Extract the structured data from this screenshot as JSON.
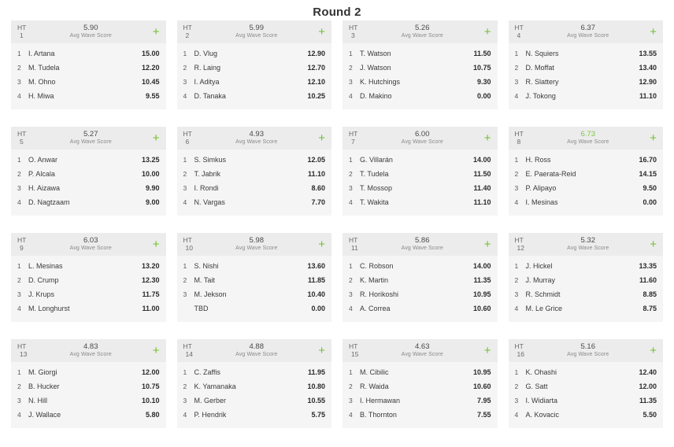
{
  "page": {
    "title": "Round 2",
    "avg_wave_score_label": "Avg Wave Score",
    "heat_prefix": "HT",
    "add_icon": "+",
    "accent_green": "#72c02c",
    "leader_green": "#7ac943",
    "header_bg": "#ececec",
    "card_bg": "#f5f5f5"
  },
  "heats": [
    {
      "number": "1",
      "avg_wave_score": "5.90",
      "is_leader": false,
      "athletes": [
        {
          "seed": "1",
          "name": "I. Artana",
          "score": "15.00"
        },
        {
          "seed": "2",
          "name": "M. Tudela",
          "score": "12.20"
        },
        {
          "seed": "3",
          "name": "M. Ohno",
          "score": "10.45"
        },
        {
          "seed": "4",
          "name": "H. Miwa",
          "score": "9.55"
        }
      ]
    },
    {
      "number": "2",
      "avg_wave_score": "5.99",
      "is_leader": false,
      "athletes": [
        {
          "seed": "1",
          "name": "D. Vlug",
          "score": "12.90"
        },
        {
          "seed": "2",
          "name": "R. Laing",
          "score": "12.70"
        },
        {
          "seed": "3",
          "name": "I. Aditya",
          "score": "12.10"
        },
        {
          "seed": "4",
          "name": "D. Tanaka",
          "score": "10.25"
        }
      ]
    },
    {
      "number": "3",
      "avg_wave_score": "5.26",
      "is_leader": false,
      "athletes": [
        {
          "seed": "1",
          "name": "T. Watson",
          "score": "11.50"
        },
        {
          "seed": "2",
          "name": "J. Watson",
          "score": "10.75"
        },
        {
          "seed": "3",
          "name": "K. Hutchings",
          "score": "9.30"
        },
        {
          "seed": "4",
          "name": "D. Makino",
          "score": "0.00"
        }
      ]
    },
    {
      "number": "4",
      "avg_wave_score": "6.37",
      "is_leader": false,
      "athletes": [
        {
          "seed": "1",
          "name": "N. Squiers",
          "score": "13.55"
        },
        {
          "seed": "2",
          "name": "D. Moffat",
          "score": "13.40"
        },
        {
          "seed": "3",
          "name": "R. Slattery",
          "score": "12.90"
        },
        {
          "seed": "4",
          "name": "J. Tokong",
          "score": "11.10"
        }
      ]
    },
    {
      "number": "5",
      "avg_wave_score": "5.27",
      "is_leader": false,
      "athletes": [
        {
          "seed": "1",
          "name": "O. Anwar",
          "score": "13.25"
        },
        {
          "seed": "2",
          "name": "P. Alcala",
          "score": "10.00"
        },
        {
          "seed": "3",
          "name": "H. Aizawa",
          "score": "9.90"
        },
        {
          "seed": "4",
          "name": "D. Nagtzaam",
          "score": "9.00"
        }
      ]
    },
    {
      "number": "6",
      "avg_wave_score": "4.93",
      "is_leader": false,
      "athletes": [
        {
          "seed": "1",
          "name": "S. Simkus",
          "score": "12.05"
        },
        {
          "seed": "2",
          "name": "T. Jabrik",
          "score": "11.10"
        },
        {
          "seed": "3",
          "name": "I. Rondi",
          "score": "8.60"
        },
        {
          "seed": "4",
          "name": "N. Vargas",
          "score": "7.70"
        }
      ]
    },
    {
      "number": "7",
      "avg_wave_score": "6.00",
      "is_leader": false,
      "athletes": [
        {
          "seed": "1",
          "name": "G. Villarán",
          "score": "14.00"
        },
        {
          "seed": "2",
          "name": "T. Tudela",
          "score": "11.50"
        },
        {
          "seed": "3",
          "name": "T. Mossop",
          "score": "11.40"
        },
        {
          "seed": "4",
          "name": "T. Wakita",
          "score": "11.10"
        }
      ]
    },
    {
      "number": "8",
      "avg_wave_score": "6.73",
      "is_leader": true,
      "athletes": [
        {
          "seed": "1",
          "name": "H. Ross",
          "score": "16.70"
        },
        {
          "seed": "2",
          "name": "E. Paerata-Reid",
          "score": "14.15"
        },
        {
          "seed": "3",
          "name": "P. Alipayo",
          "score": "9.50"
        },
        {
          "seed": "4",
          "name": "I. Mesinas",
          "score": "0.00"
        }
      ]
    },
    {
      "number": "9",
      "avg_wave_score": "6.03",
      "is_leader": false,
      "athletes": [
        {
          "seed": "1",
          "name": "L. Mesinas",
          "score": "13.20"
        },
        {
          "seed": "2",
          "name": "D. Crump",
          "score": "12.30"
        },
        {
          "seed": "3",
          "name": "J. Krups",
          "score": "11.75"
        },
        {
          "seed": "4",
          "name": "M. Longhurst",
          "score": "11.00"
        }
      ]
    },
    {
      "number": "10",
      "avg_wave_score": "5.98",
      "is_leader": false,
      "athletes": [
        {
          "seed": "1",
          "name": "S. Nishi",
          "score": "13.60"
        },
        {
          "seed": "2",
          "name": "M. Tait",
          "score": "11.85"
        },
        {
          "seed": "3",
          "name": "M. Jekson",
          "score": "10.40"
        },
        {
          "seed": "",
          "name": "TBD",
          "score": "0.00"
        }
      ]
    },
    {
      "number": "11",
      "avg_wave_score": "5.86",
      "is_leader": false,
      "athletes": [
        {
          "seed": "1",
          "name": "C. Robson",
          "score": "14.00"
        },
        {
          "seed": "2",
          "name": "K. Martin",
          "score": "11.35"
        },
        {
          "seed": "3",
          "name": "R. Horikoshi",
          "score": "10.95"
        },
        {
          "seed": "4",
          "name": "A. Correa",
          "score": "10.60"
        }
      ]
    },
    {
      "number": "12",
      "avg_wave_score": "5.32",
      "is_leader": false,
      "athletes": [
        {
          "seed": "1",
          "name": "J. Hickel",
          "score": "13.35"
        },
        {
          "seed": "2",
          "name": "J. Murray",
          "score": "11.60"
        },
        {
          "seed": "3",
          "name": "R. Schmidt",
          "score": "8.85"
        },
        {
          "seed": "4",
          "name": "M. Le Grice",
          "score": "8.75"
        }
      ]
    },
    {
      "number": "13",
      "avg_wave_score": "4.83",
      "is_leader": false,
      "athletes": [
        {
          "seed": "1",
          "name": "M. Giorgi",
          "score": "12.00"
        },
        {
          "seed": "2",
          "name": "B. Hucker",
          "score": "10.75"
        },
        {
          "seed": "3",
          "name": "N. Hill",
          "score": "10.10"
        },
        {
          "seed": "4",
          "name": "J. Wallace",
          "score": "5.80"
        }
      ]
    },
    {
      "number": "14",
      "avg_wave_score": "4.88",
      "is_leader": false,
      "athletes": [
        {
          "seed": "1",
          "name": "C. Zaffis",
          "score": "11.95"
        },
        {
          "seed": "2",
          "name": "K. Yamanaka",
          "score": "10.80"
        },
        {
          "seed": "3",
          "name": "M. Gerber",
          "score": "10.55"
        },
        {
          "seed": "4",
          "name": "P. Hendrik",
          "score": "5.75"
        }
      ]
    },
    {
      "number": "15",
      "avg_wave_score": "4.63",
      "is_leader": false,
      "athletes": [
        {
          "seed": "1",
          "name": "M. Cibilic",
          "score": "10.95"
        },
        {
          "seed": "2",
          "name": "R. Waida",
          "score": "10.60"
        },
        {
          "seed": "3",
          "name": "I. Hermawan",
          "score": "7.95"
        },
        {
          "seed": "4",
          "name": "B. Thornton",
          "score": "7.55"
        }
      ]
    },
    {
      "number": "16",
      "avg_wave_score": "5.16",
      "is_leader": false,
      "athletes": [
        {
          "seed": "1",
          "name": "K. Ohashi",
          "score": "12.40"
        },
        {
          "seed": "2",
          "name": "G. Satt",
          "score": "12.00"
        },
        {
          "seed": "3",
          "name": "I. Widiarta",
          "score": "11.35"
        },
        {
          "seed": "4",
          "name": "A. Kovacic",
          "score": "5.50"
        }
      ]
    }
  ]
}
